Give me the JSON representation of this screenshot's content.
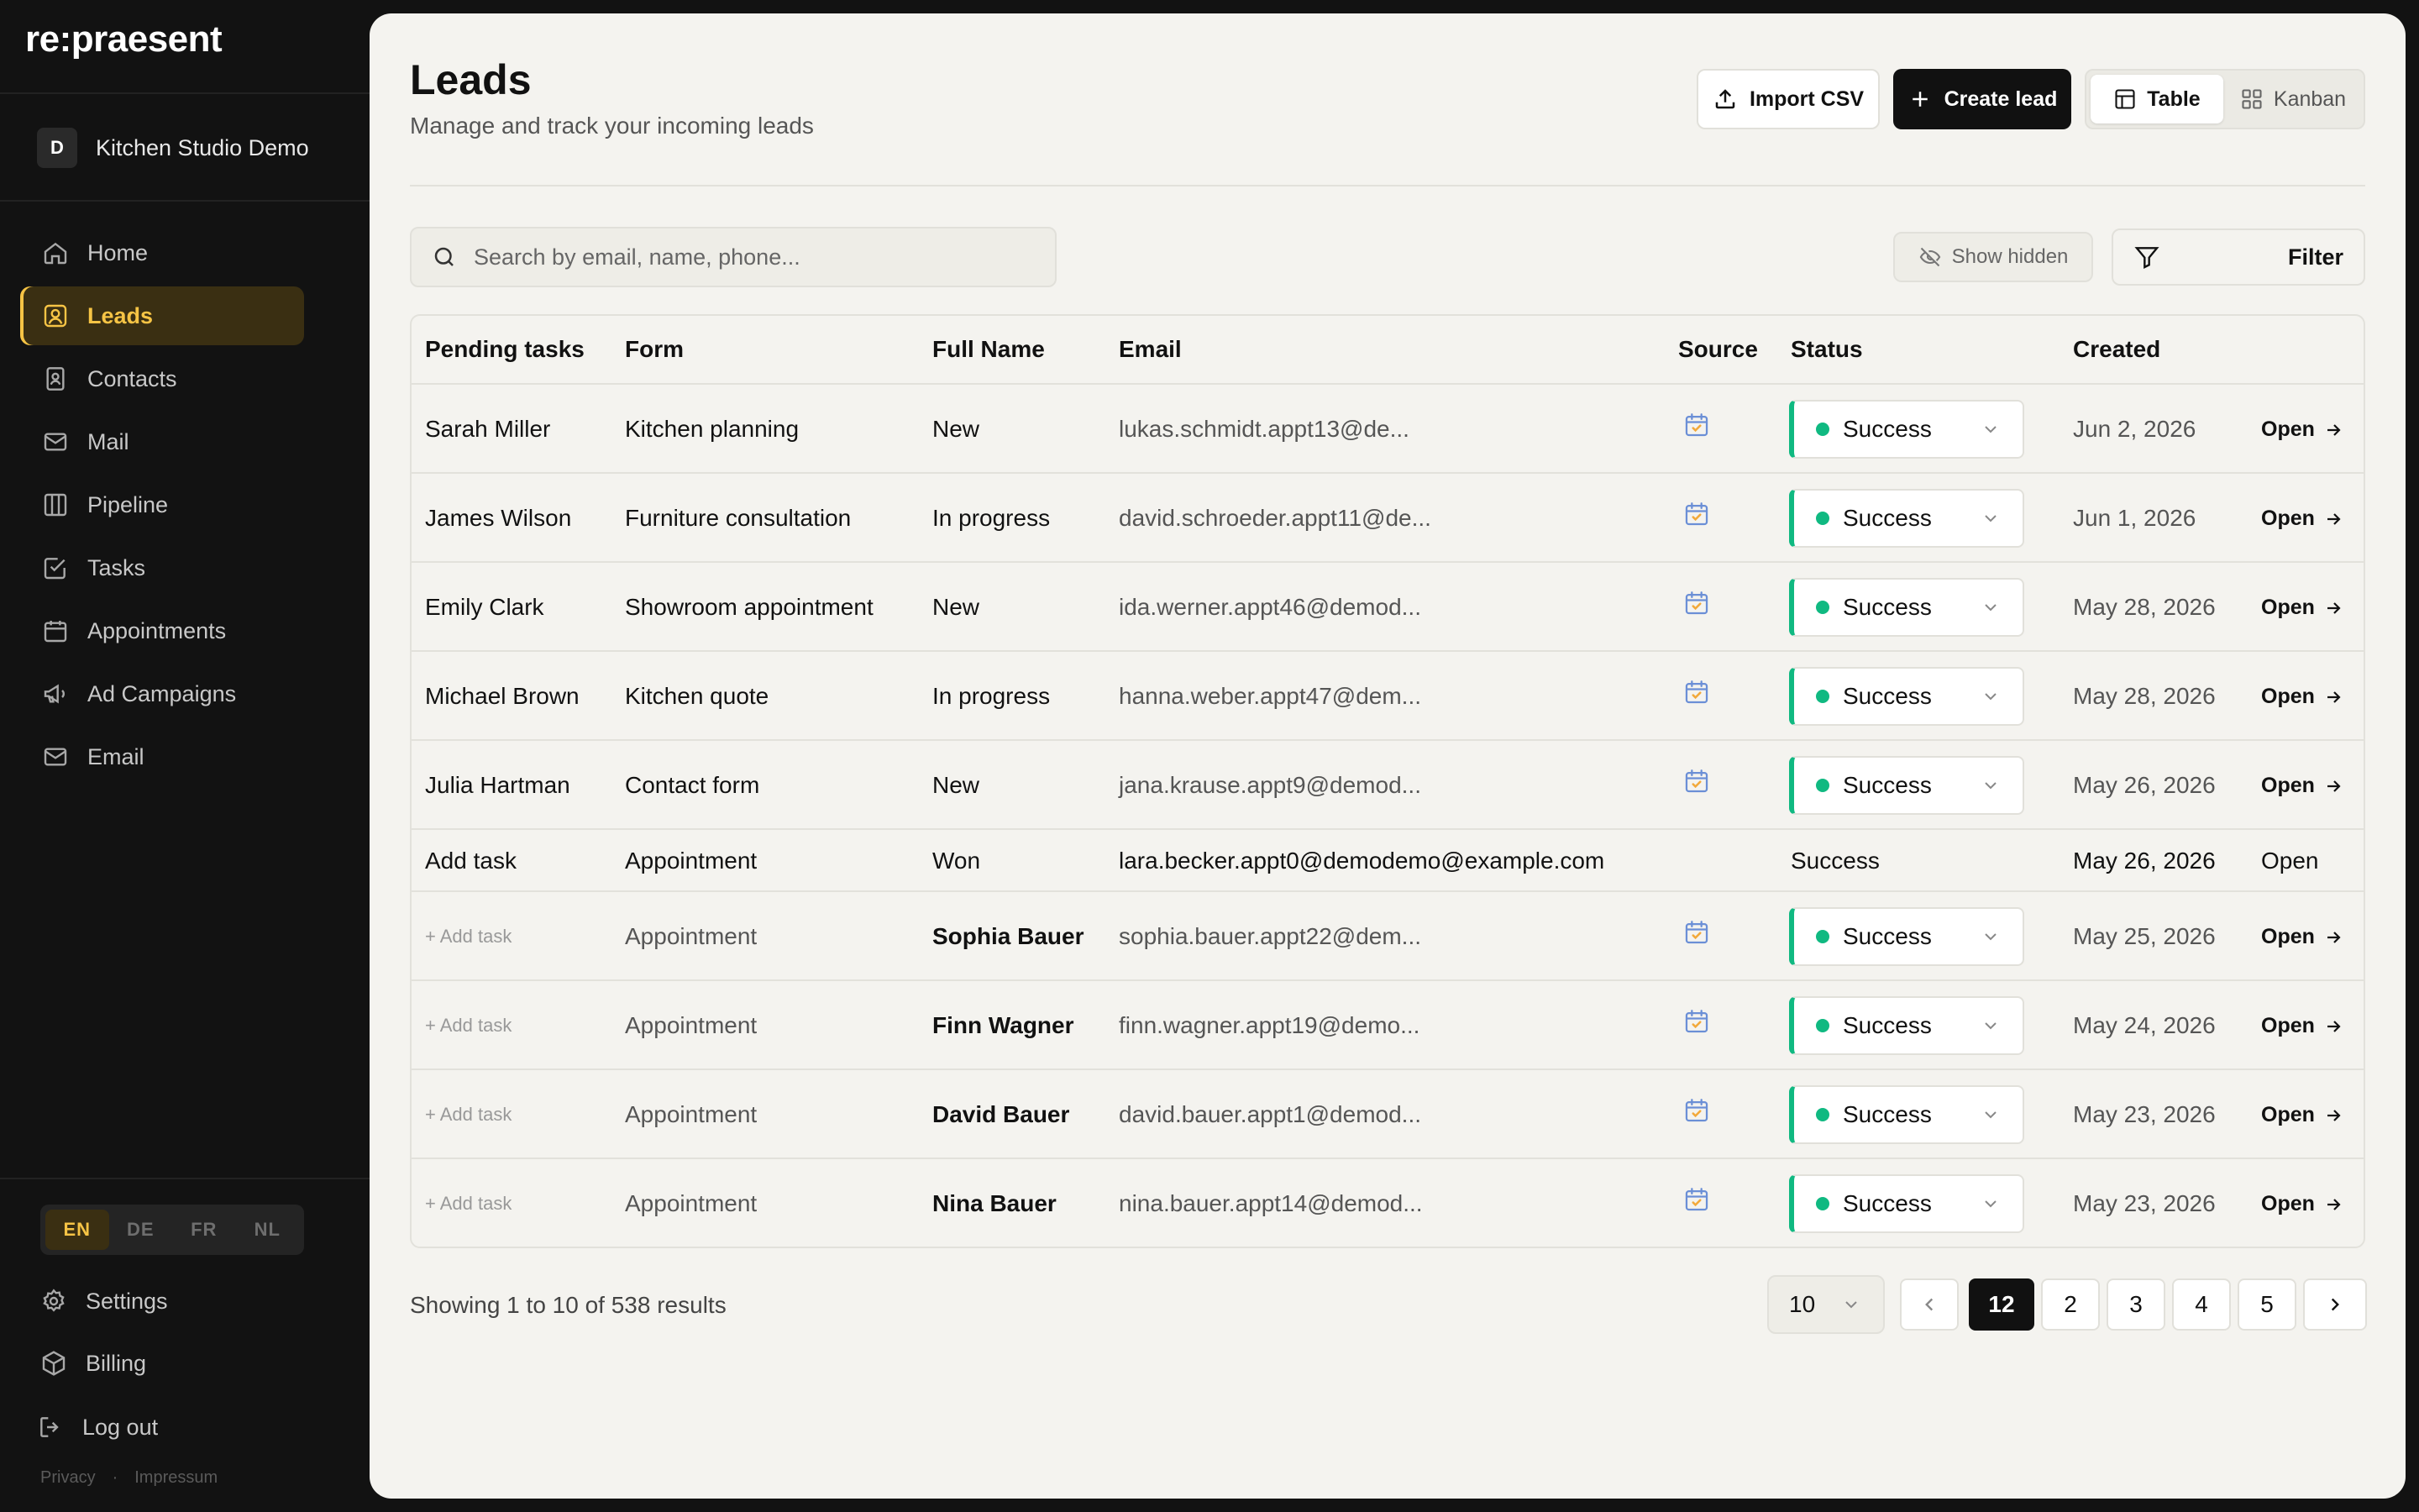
{
  "app": {
    "logo": "re:praesent",
    "workspace_initial": "D",
    "workspace_name": "Kitchen Studio Demo"
  },
  "sidebar": {
    "items": [
      {
        "label": "Home",
        "icon": "home-icon"
      },
      {
        "label": "Leads",
        "icon": "user-square-icon",
        "active": true
      },
      {
        "label": "Contacts",
        "icon": "contact-card-icon"
      },
      {
        "label": "Mail",
        "icon": "mail-icon"
      },
      {
        "label": "Pipeline",
        "icon": "columns-icon"
      },
      {
        "label": "Tasks",
        "icon": "check-square-icon"
      },
      {
        "label": "Appointments",
        "icon": "calendar-icon"
      },
      {
        "label": "Ad Campaigns",
        "icon": "megaphone-icon"
      },
      {
        "label": "Email",
        "icon": "mail-icon"
      }
    ],
    "languages": [
      "EN",
      "DE",
      "FR",
      "NL"
    ],
    "active_language": "EN",
    "settings_label": "Settings",
    "billing_label": "Billing",
    "logout_label": "Log out",
    "privacy_label": "Privacy",
    "impressum_label": "Impressum"
  },
  "header": {
    "title": "Leads",
    "subtitle": "Manage and track your incoming leads",
    "import_label": "Import CSV",
    "create_label": "Create lead",
    "view_table_label": "Table",
    "view_kanban_label": "Kanban"
  },
  "toolbar": {
    "search_placeholder": "Search by email, name, phone...",
    "show_hidden_label": "Show hidden",
    "filter_label": "Filter"
  },
  "table": {
    "columns": [
      "Pending tasks",
      "Form",
      "Full Name",
      "Email",
      "Source",
      "Status",
      "Created"
    ],
    "open_label": "Open",
    "status_color": "#10b981",
    "rows": [
      {
        "task": "Sarah Miller",
        "form": "Kitchen planning",
        "name": "New",
        "email": "lukas.schmidt.appt13@de...",
        "status": "Success",
        "created": "Jun 2, 2026"
      },
      {
        "task": "James Wilson",
        "form": "Furniture consultation",
        "name": "In progress",
        "email": "david.schroeder.appt11@de...",
        "status": "Success",
        "created": "Jun 1, 2026"
      },
      {
        "task": "Emily Clark",
        "form": "Showroom appointment",
        "name": "New",
        "email": "ida.werner.appt46@demod...",
        "status": "Success",
        "created": "May 28, 2026"
      },
      {
        "task": "Michael Brown",
        "form": "Kitchen quote",
        "name": "In progress",
        "email": "hanna.weber.appt47@dem...",
        "status": "Success",
        "created": "May 28, 2026"
      },
      {
        "task": "Julia Hartman",
        "form": "Contact form",
        "name": "New",
        "email": "jana.krause.appt9@demod...",
        "status": "Success",
        "created": "May 26, 2026"
      },
      {
        "task": "Add task",
        "form": "Appointment",
        "name": "Won",
        "email": "lara.becker.appt0@demodemo@example.com",
        "status": "Success",
        "created": "May 26, 2026",
        "plain": true
      },
      {
        "task": "Add task",
        "form": "Appointment",
        "name": "Sophia Bauer",
        "email": "sophia.bauer.appt22@dem...",
        "status": "Success",
        "created": "May 25, 2026"
      },
      {
        "task": "Add task",
        "form": "Appointment",
        "name": "Finn Wagner",
        "email": "finn.wagner.appt19@demo...",
        "status": "Success",
        "created": "May 24, 2026"
      },
      {
        "task": "Add task",
        "form": "Appointment",
        "name": "David Bauer",
        "email": "david.bauer.appt1@demod...",
        "status": "Success",
        "created": "May 23, 2026"
      },
      {
        "task": "Add task",
        "form": "Appointment",
        "name": "Nina Bauer",
        "email": "nina.bauer.appt14@demod...",
        "status": "Success",
        "created": "May 23, 2026"
      }
    ]
  },
  "pagination": {
    "summary": "Showing 1 to 10 of 538 results",
    "per_page": "10",
    "pages": [
      "12",
      "2",
      "3",
      "4",
      "5"
    ],
    "current": "12"
  }
}
